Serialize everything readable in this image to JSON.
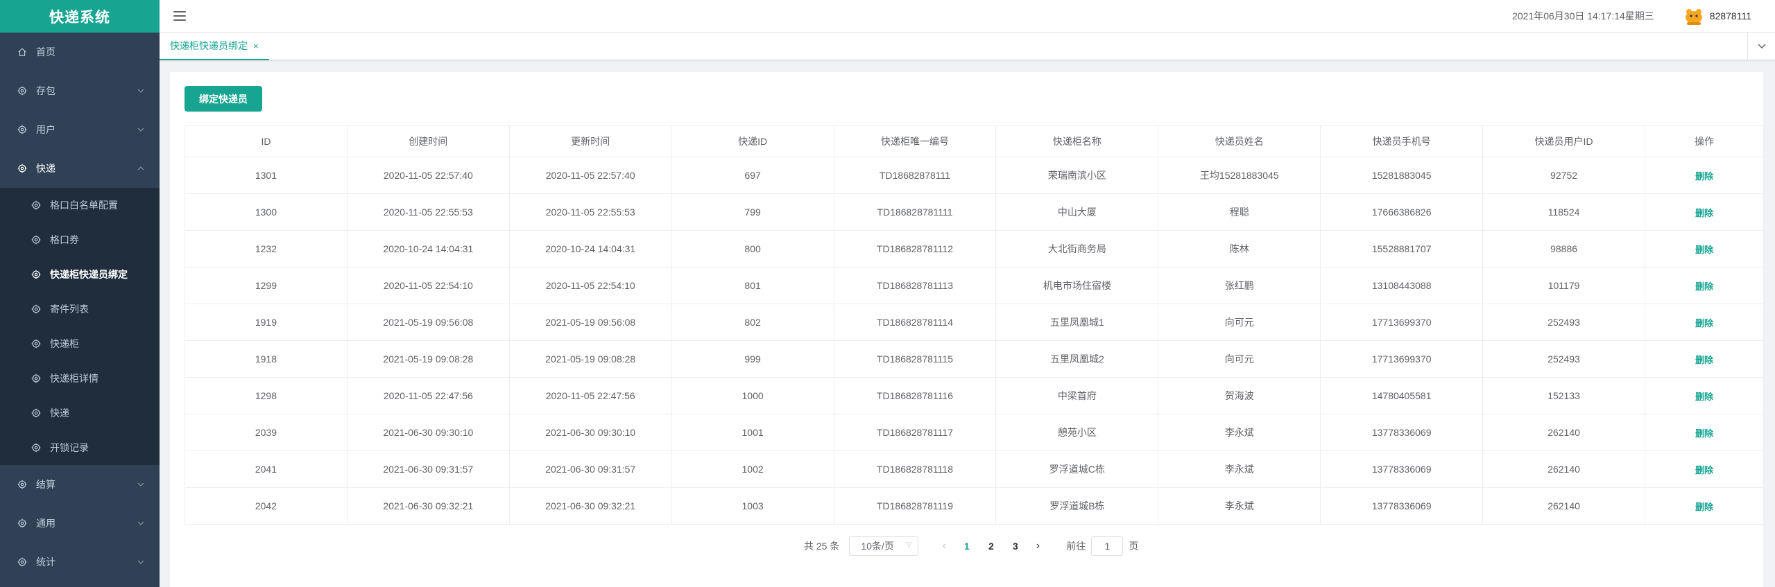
{
  "app": {
    "title": "快递系统"
  },
  "header": {
    "datetime": "2021年06月30日 14:17:14星期三",
    "username": "82878111"
  },
  "sidebar": {
    "items": [
      {
        "label": "首页",
        "icon": "home-icon",
        "expandable": false
      },
      {
        "label": "存包",
        "icon": "gear-icon",
        "expandable": true
      },
      {
        "label": "用户",
        "icon": "gear-icon",
        "expandable": true
      },
      {
        "label": "快递",
        "icon": "gear-icon",
        "expandable": true,
        "open": true
      },
      {
        "label": "结算",
        "icon": "gear-icon",
        "expandable": true
      },
      {
        "label": "通用",
        "icon": "gear-icon",
        "expandable": true
      },
      {
        "label": "统计",
        "icon": "gear-icon",
        "expandable": true
      }
    ],
    "submenu": [
      {
        "label": "格口白名单配置"
      },
      {
        "label": "格口券"
      },
      {
        "label": "快递柜快递员绑定",
        "active": true
      },
      {
        "label": "寄件列表"
      },
      {
        "label": "快递柜"
      },
      {
        "label": "快递柜详情"
      },
      {
        "label": "快递"
      },
      {
        "label": "开锁记录"
      }
    ]
  },
  "tags": {
    "active_label": "快递柜快递员绑定",
    "close_symbol": "×"
  },
  "toolbar": {
    "bind_button": "绑定快递员"
  },
  "table": {
    "headers": [
      "ID",
      "创建时间",
      "更新时间",
      "快递ID",
      "快递柜唯一编号",
      "快递柜名称",
      "快递员姓名",
      "快递员手机号",
      "快递员用户ID",
      "操作"
    ],
    "rows": [
      [
        "1301",
        "2020-11-05 22:57:40",
        "2020-11-05 22:57:40",
        "697",
        "TD18682878111",
        "荣瑞南滨小区",
        "王均15281883045",
        "15281883045",
        "92752",
        "删除"
      ],
      [
        "1300",
        "2020-11-05 22:55:53",
        "2020-11-05 22:55:53",
        "799",
        "TD186828781111",
        "中山大厦",
        "程聪",
        "17666386826",
        "118524",
        "删除"
      ],
      [
        "1232",
        "2020-10-24 14:04:31",
        "2020-10-24 14:04:31",
        "800",
        "TD186828781112",
        "大北街商务局",
        "陈林",
        "15528881707",
        "98886",
        "删除"
      ],
      [
        "1299",
        "2020-11-05 22:54:10",
        "2020-11-05 22:54:10",
        "801",
        "TD186828781113",
        "机电市场住宿楼",
        "张红鹏",
        "13108443088",
        "101179",
        "删除"
      ],
      [
        "1919",
        "2021-05-19 09:56:08",
        "2021-05-19 09:56:08",
        "802",
        "TD186828781114",
        "五里凤凰城1",
        "向可元",
        "17713699370",
        "252493",
        "删除"
      ],
      [
        "1918",
        "2021-05-19 09:08:28",
        "2021-05-19 09:08:28",
        "999",
        "TD186828781115",
        "五里凤凰城2",
        "向可元",
        "17713699370",
        "252493",
        "删除"
      ],
      [
        "1298",
        "2020-11-05 22:47:56",
        "2020-11-05 22:47:56",
        "1000",
        "TD186828781116",
        "中梁首府",
        "贺海波",
        "14780405581",
        "152133",
        "删除"
      ],
      [
        "2039",
        "2021-06-30 09:30:10",
        "2021-06-30 09:30:10",
        "1001",
        "TD186828781117",
        "憩苑小区",
        "李永斌",
        "13778336069",
        "262140",
        "删除"
      ],
      [
        "2041",
        "2021-06-30 09:31:57",
        "2021-06-30 09:31:57",
        "1002",
        "TD186828781118",
        "罗浮道城C栋",
        "李永斌",
        "13778336069",
        "262140",
        "删除"
      ],
      [
        "2042",
        "2021-06-30 09:32:21",
        "2021-06-30 09:32:21",
        "1003",
        "TD186828781119",
        "罗浮道城B栋",
        "李永斌",
        "13778336069",
        "262140",
        "删除"
      ]
    ]
  },
  "pagination": {
    "total": "共 25 条",
    "page_size": "10条/页",
    "pages": [
      "1",
      "2",
      "3"
    ],
    "current": "1",
    "goto_prefix": "前往",
    "goto_value": "1",
    "goto_suffix": "页"
  },
  "colors": {
    "accent": "#17a592",
    "sidebar": "#304156",
    "submenu": "#1f2d3d"
  }
}
